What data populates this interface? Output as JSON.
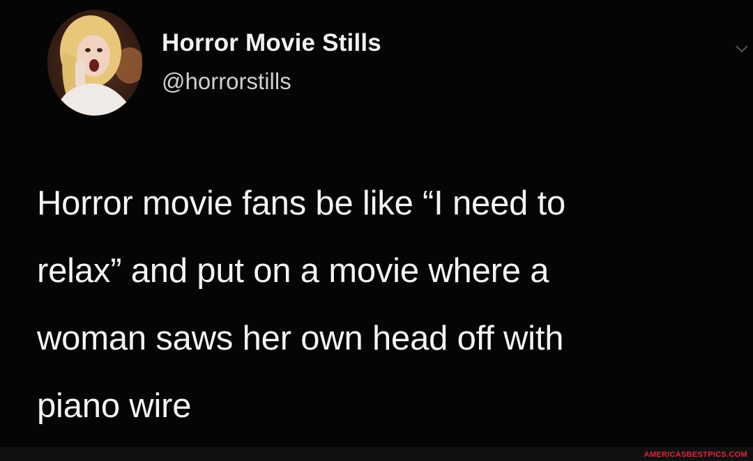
{
  "profile": {
    "display_name": "Horror Movie Stills",
    "handle": "@horrorstills",
    "avatar_icon": "profile-photo-icon"
  },
  "tweet": {
    "text": "Horror movie fans be like “I need to\nrelax” and put on a movie where a\nwoman saws her own head off with\npiano wire"
  },
  "watermark": {
    "text": "AMERICASBESTPICS.COM",
    "color": "#e0263a"
  },
  "colors": {
    "background": "#050505",
    "text": "#f4f4f4",
    "handle": "#cfcfcf"
  }
}
